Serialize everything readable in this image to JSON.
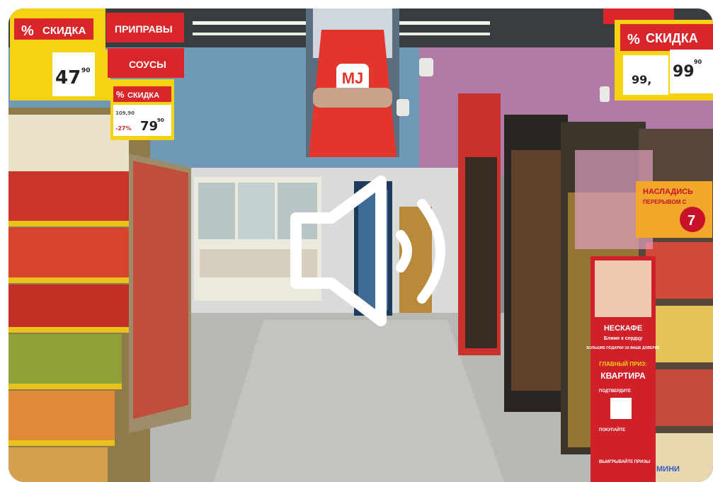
{
  "scene": {
    "signs": {
      "discount_left": "СКИДКА",
      "discount_left_small": "СКИДКА",
      "discount_right": "СКИДКА",
      "seasonings": "ПРИПРАВЫ",
      "sauces": "СОУСЫ",
      "percent": "%",
      "logo": "МЈ"
    },
    "prices": {
      "left_main": "47",
      "left_main_cents": "90",
      "left_small": "79",
      "left_small_cents": "90",
      "left_small_old": "109,90",
      "left_small_discount": "-27%",
      "right_main": "99",
      "right_main_cents": "90",
      "right_small": "99,"
    },
    "promo": {
      "brand": "НЕСКАФЕ",
      "tagline": "Ближе к сердцу",
      "gifts": "БОЛЬШИЕ ПОДАРКИ ЗА ВАШЕ ДОВЕРИЕ",
      "prize_label": "ГЛАВНЫЙ ПРИЗ:",
      "prize": "КВАРТИРА",
      "step_1": "ПОДТВЕРДИТЕ",
      "step_2": "ПОКУПАЙТЕ",
      "step_3": "ВЫИГРЫВАЙТЕ ПРИЗЫ"
    },
    "seven_days": {
      "line1": "НАСЛАДИСЬ",
      "line2": "ПЕРЕРЫВОМ С",
      "logo": "7"
    },
    "brand_mini": "МИНИ"
  },
  "colors": {
    "sign_red": "#d8262b",
    "sign_yellow": "#f5d314",
    "shelf_yellow": "#e6c21a",
    "wall_blue": "#6e9ab8",
    "wall_purple": "#b27aa6",
    "floor": "#b7b9b4"
  },
  "overlay": {
    "icon": "speaker-sound-icon"
  }
}
